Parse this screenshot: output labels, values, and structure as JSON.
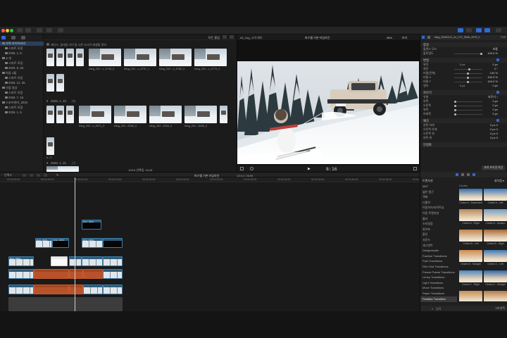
{
  "toolbar": {
    "transcode_label": "",
    "right_buttons": [
      "",
      "",
      ""
    ]
  },
  "sidebar": {
    "items": [
      {
        "label": "가족 라이브러리",
        "selected": true
      },
      {
        "label": "스마트 모음",
        "selected": false
      },
      {
        "label": "2026. 1. 8.",
        "selected": false
      },
      {
        "label": "소개",
        "selected": false
      },
      {
        "label": "스마트 모음",
        "selected": false
      },
      {
        "label": "2026. 6. 26.",
        "selected": false
      },
      {
        "label": "아들 1월",
        "selected": false
      },
      {
        "label": "스마트 모음",
        "selected": false
      },
      {
        "label": "2026. 12. 30.",
        "selected": false
      },
      {
        "label": "산들 영상",
        "selected": false
      },
      {
        "label": "스마트 모음",
        "selected": false
      },
      {
        "label": "2026. 7. 16.",
        "selected": false
      },
      {
        "label": "스포츠센터_2026",
        "selected": false
      },
      {
        "label": "스마트 모음",
        "selected": false
      },
      {
        "label": "2026. 1. 8.",
        "selected": false
      }
    ]
  },
  "browser": {
    "filter_label": "모든 클립",
    "path_text": "캐너스, 썸네일 사이 및 시즌 사시작 재생할 준비",
    "group1_date": "2026. 1. 22.",
    "group1_count": "(9)",
    "group2_date": "2026. 1. 21.",
    "group2_count": "(7)",
    "footer": "10/18 선택됨, 16:49",
    "top_row_labels": [
      "kling_202...o_5745_0",
      "kling_202...o_5757_1",
      "kling_202...o_5765_0",
      "kling_202...o_5779_0"
    ],
    "mid_row_labels": [
      "kling_202...o_5971_0",
      "kling_202...6268_0",
      "kling_202...4334_0",
      "kling_202...5066_0"
    ],
    "bottom_label": "k...0"
  },
  "viewer": {
    "clip_name": "IM_Zag_시아 레이",
    "project_name": "파스텔 기본 타임라인",
    "zoom": "48%",
    "view_label": "보기",
    "timecode": "8:16"
  },
  "inspector": {
    "file_name": "kling_20260121_Im_27V_SIWa_9975_0",
    "duration": "7:13",
    "sections": {
      "compositing": "합성",
      "transform": "변형",
      "crop": "자르기",
      "distort": "왜곡",
      "stabilize": "안정화"
    },
    "rows": {
      "blend_mode": "블렌드 모드",
      "blend_value": "보통",
      "opacity": "불투명도",
      "opacity_value": "100.0 %",
      "position": "위치",
      "position_x": "0 px",
      "position_y": "0 px",
      "rotation": "회전",
      "rotation_value": "0 °",
      "scale_all": "비율(전체)",
      "scale_all_value": "100 %",
      "scale_x": "비율 X",
      "scale_x_value": "100.0 %",
      "scale_y": "비율 Y",
      "scale_y_value": "100.0 %",
      "anchor": "앵커",
      "anchor_x": "0 px",
      "anchor_y": "0 px",
      "crop_type": "유형",
      "crop_type_value": "자르기 ↕",
      "left": "왼쪽",
      "right": "오른쪽",
      "top": "위쪽",
      "bottom": "아래쪽",
      "zero_px": "0 px",
      "bottom_left": "왼쪽 아래",
      "bottom_right": "오른쪽 아래",
      "top_right": "오른쪽 위",
      "top_left": "왼쪽 위",
      "zero_pair": "0 px   0"
    },
    "save_preset": "효과 프리셋 저장"
  },
  "timeline": {
    "index_label": "인덱스",
    "project_label": "파스텔 기본 타임라인",
    "timecode": "13:14 / 26:55",
    "ticks": [
      "00:00:00:00",
      "00:00:05:00",
      "00:00:10:00",
      "00:00:15:00",
      "00:00:20:00",
      "00:00:25:00",
      "00:00:30:00",
      "00:00:35:00",
      "00:00:40:00",
      "00:00:45:00",
      "00:00:50:00",
      "00:00:55:00",
      "00:01:00:00"
    ],
    "clip_labels": [
      "kling_2026...",
      "kling_2026...",
      "kling_2026...",
      "kling_2026...",
      "kling_2026..."
    ]
  },
  "transitions": {
    "header": "트랜지션",
    "all_label": "카테고리",
    "installed_label": "설치됨 ▾",
    "categories": [
      {
        "label": "360°",
        "selected": false
      },
      {
        "label": "넓은 원근",
        "selected": false
      },
      {
        "label": "객체",
        "selected": false
      },
      {
        "label": "디졸브",
        "selected": false
      },
      {
        "label": "이동하기/라이트닝",
        "selected": false
      },
      {
        "label": "이동 트랜지션",
        "selected": false
      },
      {
        "label": "블러",
        "selected": false
      },
      {
        "label": "스타일링",
        "selected": false
      },
      {
        "label": "와이프",
        "selected": false
      },
      {
        "label": "줌인",
        "selected": false
      },
      {
        "label": "사운드",
        "selected": false
      },
      {
        "label": "세그먼트",
        "selected": false
      },
      {
        "label": "Designstudio",
        "selected": false
      },
      {
        "label": "Fashion Transitions",
        "selected": false
      },
      {
        "label": "Fast Transitions",
        "selected": false
      },
      {
        "label": "Film Grid Transitions",
        "selected": false
      },
      {
        "label": "Freeze Frame Transitions",
        "selected": false
      },
      {
        "label": "Lenny Transitions",
        "selected": false
      },
      {
        "label": "Light Transitions",
        "selected": false
      },
      {
        "label": "Move Transitions",
        "selected": false
      },
      {
        "label": "Paper Transitions",
        "selected": false
      },
      {
        "label": "Parallax Transition",
        "selected": true
      }
    ],
    "group_label": "Circles",
    "items": [
      {
        "label": "Circles A - Downward",
        "color": "#2f6fb0"
      },
      {
        "label": "Circles A - Left",
        "color": "#3a7cc2"
      },
      {
        "label": "Circles A - Right",
        "color": "#b8865a"
      },
      {
        "label": "Circles A - Upward",
        "color": "#6f9fcf"
      },
      {
        "label": "Circles B - Left",
        "color": "#c0844e"
      },
      {
        "label": "Circles B - Right",
        "color": "#a7673a"
      },
      {
        "label": "Circles B - Straight",
        "color": "#d08a4e"
      },
      {
        "label": "Circles C - Left",
        "color": "#3d78b5"
      },
      {
        "label": "Circles C - Right",
        "color": "#4b85c1"
      },
      {
        "label": "Circles C - Straight",
        "color": "#2f66a3"
      },
      {
        "label": "",
        "color": "#c98c55"
      },
      {
        "label": "",
        "color": "#b77a48"
      }
    ],
    "search_placeholder": "검색",
    "count_label": "3개 항목"
  }
}
